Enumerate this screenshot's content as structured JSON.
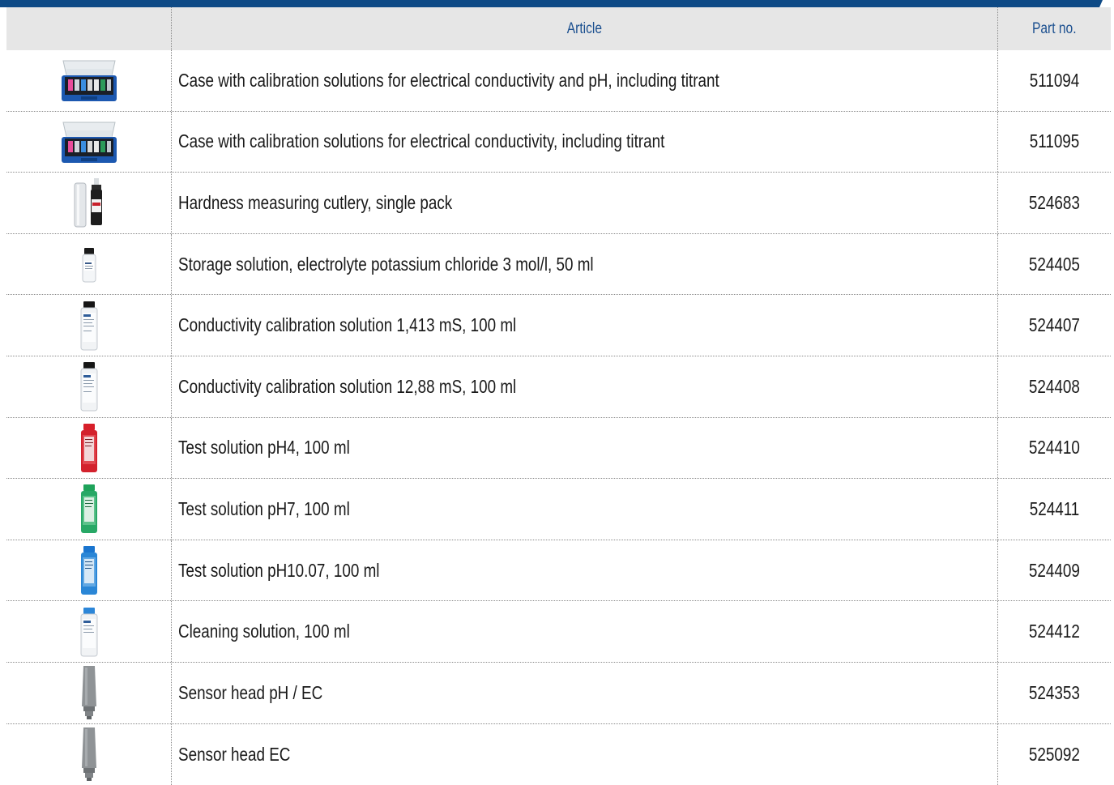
{
  "colors": {
    "brand": "#0e4a86",
    "header_bg": "#e6e6e6",
    "header_text": "#1b4f8f"
  },
  "table": {
    "headers": {
      "image": "",
      "article": "Article",
      "part_no": "Part no."
    },
    "rows": [
      {
        "thumb": "case-blue-icon",
        "article": "Case with calibration solutions for electrical conductivity and pH, including titrant",
        "part_no": "511094"
      },
      {
        "thumb": "case-blue-icon",
        "article": "Case with calibration solutions for electrical conductivity, including titrant",
        "part_no": "511095"
      },
      {
        "thumb": "cutlery-set-icon",
        "article": "Hardness measuring cutlery, single pack",
        "part_no": "524683"
      },
      {
        "thumb": "small-bottle-icon",
        "article": "Storage solution, electrolyte potassium chloride 3 mol/l, 50 ml",
        "part_no": "524405"
      },
      {
        "thumb": "bottle-white-icon",
        "article": "Conductivity calibration solution 1,413 mS, 100 ml",
        "part_no": "524407"
      },
      {
        "thumb": "bottle-white-icon",
        "article": "Conductivity calibration solution 12,88 mS, 100 ml",
        "part_no": "524408"
      },
      {
        "thumb": "bottle-red-icon",
        "article": "Test solution pH4, 100 ml",
        "part_no": "524410"
      },
      {
        "thumb": "bottle-green-icon",
        "article": "Test solution pH7, 100 ml",
        "part_no": "524411"
      },
      {
        "thumb": "bottle-blue-icon",
        "article": "Test solution pH10.07, 100 ml",
        "part_no": "524409"
      },
      {
        "thumb": "bottle-white-bluecap-icon",
        "article": "Cleaning solution, 100 ml",
        "part_no": "524412"
      },
      {
        "thumb": "sensor-head-icon",
        "article": "Sensor head pH / EC",
        "part_no": "524353"
      },
      {
        "thumb": "sensor-head-icon",
        "article": "Sensor head EC",
        "part_no": "525092"
      }
    ]
  }
}
